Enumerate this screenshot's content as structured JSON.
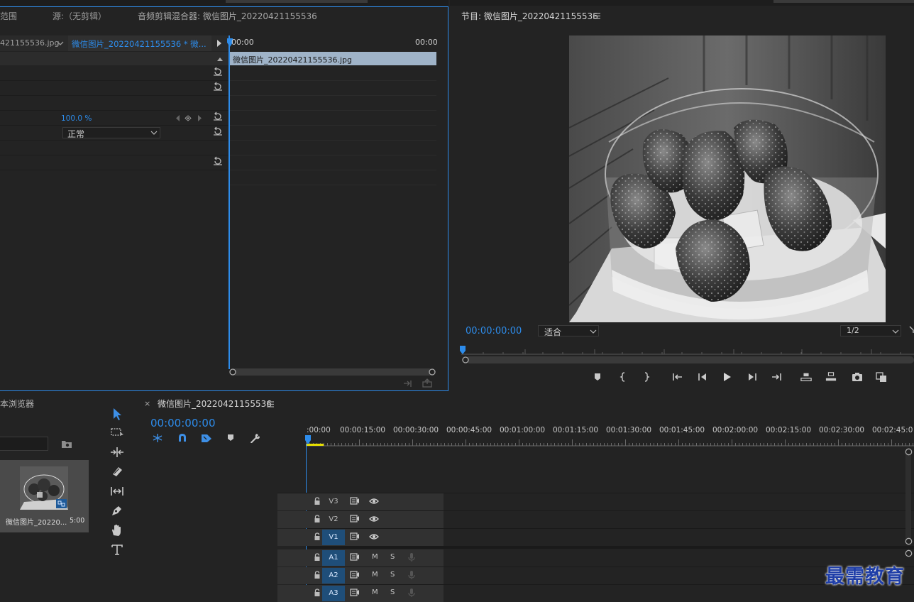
{
  "top_tabs": {
    "range_fragment": "范围",
    "source_tab": "源:（无剪辑）",
    "audio_mixer_tab": "音频剪辑混合器: 微信图片_20220421155536",
    "program_title": "节目: 微信图片_20220421155536"
  },
  "effects_controls": {
    "source_clip": "421155536.jpg",
    "sequence_clip": "微信图片_20220421155536 * 微...",
    "opacity_value": "100.0 %",
    "blend_mode": "正常",
    "mini_timeline_start": "00:00",
    "mini_timeline_end": "00:00",
    "clip_bar_label": "微信图片_20220421155536.jpg"
  },
  "program_monitor": {
    "timecode": "00:00:00:00",
    "fit_label": "适合",
    "resolution_label": "1/2",
    "image_description_icon": "strawberry-cake-photo"
  },
  "media_browser": {
    "title": "本浏览器",
    "thumb_label": "微信图片_20220...",
    "thumb_duration": "5:00"
  },
  "timeline": {
    "close_glyph": "×",
    "sequence_name": "微信图片_20220421155536",
    "timecode": "00:00:00:00",
    "ruler": [
      ":00:00",
      "00:00:15:00",
      "00:00:30:00",
      "00:00:45:00",
      "00:01:00:00",
      "00:01:15:00",
      "00:01:30:00",
      "00:01:45:00",
      "00:02:00:00",
      "00:02:15:00",
      "00:02:30:00",
      "00:02:45:0"
    ],
    "tracks_video": [
      "V3",
      "V2",
      "V1"
    ],
    "tracks_audio": [
      "A1",
      "A2",
      "A3"
    ],
    "mute_label": "M",
    "solo_label": "S"
  },
  "watermark": "最需教育",
  "colors": {
    "accent_blue": "#2d8ceb",
    "clip_pink": "#e38be0",
    "panel_bg": "#232323",
    "active_track": "#1f4e79"
  }
}
